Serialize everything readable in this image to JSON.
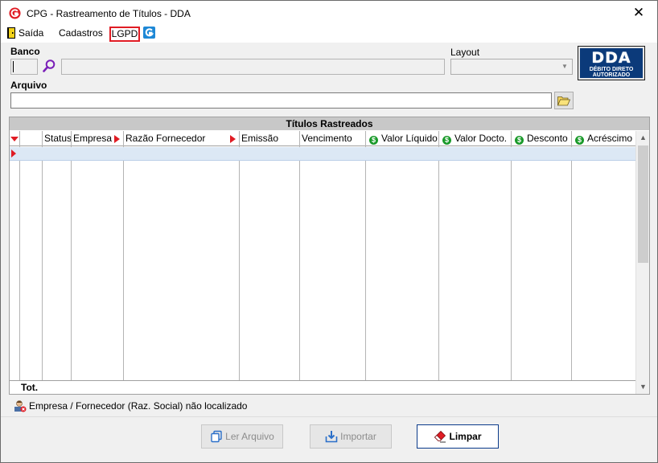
{
  "window": {
    "title": "CPG - Rastreamento de Títulos - DDA",
    "close_glyph": "✕"
  },
  "menu": {
    "items": [
      {
        "label": "Saída",
        "icon": "door-exit-icon"
      },
      {
        "label": "Cadastros"
      },
      {
        "label": "LGPD",
        "highlighted": true
      }
    ],
    "g_icon": "app-g-icon"
  },
  "form": {
    "banco_label": "Banco",
    "banco_code": "",
    "banco_name": "",
    "layout_label": "Layout",
    "layout_value": "",
    "arquivo_label": "Arquivo",
    "arquivo_value": ""
  },
  "logo": {
    "big": "DDA",
    "line1": "DÉBITO DIRETO",
    "line2": "AUTORIZADO",
    "bg_color": "#0b3a7a"
  },
  "grid": {
    "caption": "Títulos Rastreados",
    "columns": [
      {
        "label": ""
      },
      {
        "label": "Status"
      },
      {
        "label": "Empresa"
      },
      {
        "label": "Razão Fornecedor"
      },
      {
        "label": "Emissão"
      },
      {
        "label": "Vencimento"
      },
      {
        "label": "Valor Líquido",
        "icon": "dollar-icon"
      },
      {
        "label": "Valor Docto.",
        "icon": "dollar-icon"
      },
      {
        "label": "Desconto",
        "icon": "dollar-icon"
      },
      {
        "label": "Acréscimo",
        "icon": "dollar-icon"
      }
    ],
    "total_label": "Tot.",
    "selected_row_color": "#dce8f5"
  },
  "status": {
    "message": "Empresa / Fornecedor (Raz. Social) não localizado"
  },
  "buttons": {
    "ler_arquivo": "Ler Arquivo",
    "importar": "Importar",
    "limpar": "Limpar"
  },
  "colors": {
    "accent_red": "#e01c24",
    "primary_border": "#0a3a8a"
  }
}
